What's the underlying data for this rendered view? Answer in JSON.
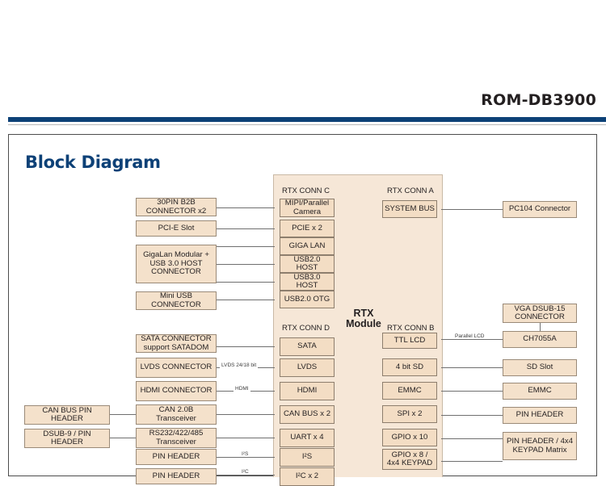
{
  "header": {
    "doc_title": "ROM-DB3900",
    "rule_color": "#0d4177"
  },
  "section": {
    "title": "Block Diagram",
    "title_color": "#0d4177"
  },
  "rtx_module": {
    "label": "RTX Module",
    "panel_color": "#f6e7d7",
    "box_color": "#f4e1cb"
  },
  "conn_headings": {
    "conn_c": "RTX CONN C",
    "conn_a": "RTX CONN A",
    "conn_d": "RTX CONN D",
    "conn_b": "RTX CONN B"
  },
  "conn_c_signals": [
    {
      "label": "MIPI/Parallel Camera"
    },
    {
      "label": "PCIE x 2"
    },
    {
      "label": "GIGA LAN"
    },
    {
      "label": "USB2.0 HOST"
    },
    {
      "label": "USB3.0 HOST"
    },
    {
      "label": "USB2.0 OTG"
    }
  ],
  "conn_a_signals": [
    {
      "label": "SYSTEM BUS"
    }
  ],
  "conn_d_signals": [
    {
      "label": "SATA"
    },
    {
      "label": "LVDS"
    },
    {
      "label": "HDMI"
    },
    {
      "label": "CAN BUS x 2"
    },
    {
      "label": "UART x 4"
    },
    {
      "label": "I²S"
    },
    {
      "label": "I²C x 2"
    }
  ],
  "conn_b_signals": [
    {
      "label": "TTL LCD"
    },
    {
      "label": "4 bit SD"
    },
    {
      "label": "EMMC"
    },
    {
      "label": "SPI x 2"
    },
    {
      "label": "GPIO x 10"
    },
    {
      "label": "GPIO x 8 / 4x4 KEYPAD"
    }
  ],
  "left_inner_boxes": [
    {
      "label": "30PIN B2B CONNECTOR x2"
    },
    {
      "label": "PCI-E Slot"
    },
    {
      "label": "GigaLan Modular + USB 3.0 HOST CONNECTOR"
    },
    {
      "label": "Mini USB CONNECTOR"
    },
    {
      "label": "SATA CONNECTOR support SATADOM"
    },
    {
      "label": "LVDS CONNECTOR"
    },
    {
      "label": "HDMI CONNECTOR"
    },
    {
      "label": "CAN 2.0B Transceiver"
    },
    {
      "label": "RS232/422/485 Transceiver"
    },
    {
      "label": "PIN HEADER"
    },
    {
      "label": "PIN HEADER"
    }
  ],
  "left_outer_boxes": [
    {
      "label": "CAN BUS PIN HEADER"
    },
    {
      "label": "DSUB-9 / PIN HEADER"
    }
  ],
  "right_boxes": [
    {
      "label": "PC104 Connector"
    },
    {
      "label": "VGA DSUB-15 CONNECTOR"
    },
    {
      "label": "CH7055A"
    },
    {
      "label": "SD Slot"
    },
    {
      "label": "EMMC"
    },
    {
      "label": "PIN HEADER"
    },
    {
      "label": "PIN HEADER / 4x4 KEYPAD Matrix"
    }
  ],
  "bus_labels": [
    {
      "label": "LVDS 24/18 bit"
    },
    {
      "label": "HDMI"
    },
    {
      "label": "I²S"
    },
    {
      "label": "I²C"
    },
    {
      "label": "Parallel LCD"
    }
  ]
}
